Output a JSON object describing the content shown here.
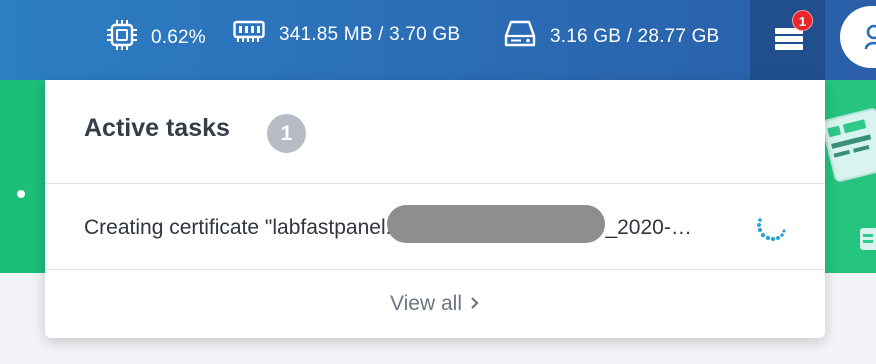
{
  "topbar": {
    "cpu": {
      "icon": "cpu-icon",
      "value": "0.62%"
    },
    "memory": {
      "icon": "memory-icon",
      "value": "341.85 MB / 3.70 GB"
    },
    "disk": {
      "icon": "disk-icon",
      "value": "3.16 GB / 28.77 GB"
    },
    "tasks_button": {
      "icon": "server-stack-icon",
      "badge": "1"
    },
    "user_button": {
      "icon": "user-icon"
    }
  },
  "panel": {
    "title": "Active tasks",
    "count": "1",
    "tasks": [
      {
        "text_before": "Creating certificate \"labfastpanel.",
        "text_after": "_2020-…",
        "status_icon": "loading-spinner-icon"
      }
    ],
    "view_all": "View all"
  },
  "colors": {
    "topbar": "#2b6fb8",
    "tasks_button_bg": "#214f8d",
    "badge_red": "#e8262c",
    "banner_green": "#20c07c",
    "spinner_blue": "#2aa3d8"
  }
}
